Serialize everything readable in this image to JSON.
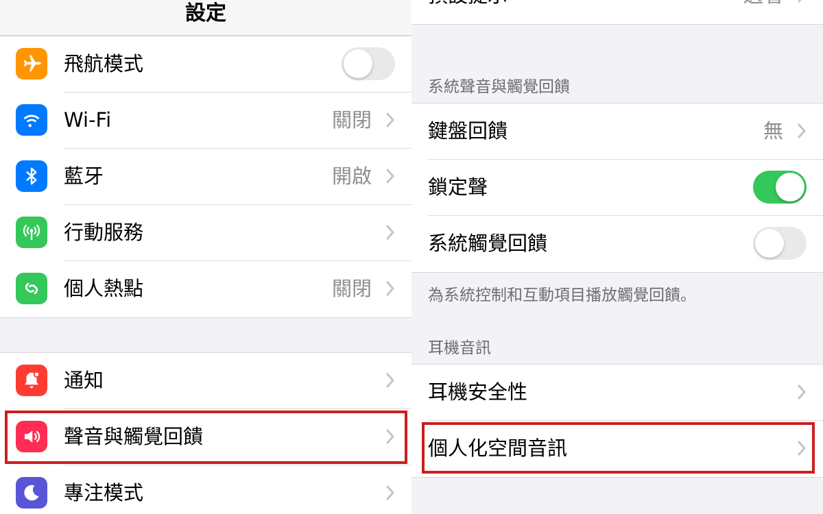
{
  "left": {
    "nav_title": "設定",
    "group1": [
      {
        "label": "飛航模式",
        "icon": "airplane-icon",
        "color": "#ff9500",
        "toggle": false
      },
      {
        "label": "Wi-Fi",
        "icon": "wifi-icon",
        "color": "#007aff",
        "value": "關閉"
      },
      {
        "label": "藍牙",
        "icon": "bluetooth-icon",
        "color": "#007aff",
        "value": "開啟"
      },
      {
        "label": "行動服務",
        "icon": "cellular-icon",
        "color": "#34c759",
        "value": ""
      },
      {
        "label": "個人熱點",
        "icon": "hotspot-icon",
        "color": "#34c759",
        "value": "關閉"
      }
    ],
    "group2": [
      {
        "label": "通知",
        "icon": "bell-icon",
        "color": "#ff3b30"
      },
      {
        "label": "聲音與觸覺回饋",
        "icon": "speaker-icon",
        "color": "#ff2d55",
        "highlighted": true
      },
      {
        "label": "專注模式",
        "icon": "moon-icon",
        "color": "#5856d6"
      }
    ]
  },
  "right": {
    "top_row": {
      "label": "預設提示",
      "value": "過看"
    },
    "section1_header": "系統聲音與觸覺回饋",
    "section1": [
      {
        "label": "鍵盤回饋",
        "value": "無"
      },
      {
        "label": "鎖定聲",
        "toggle": true
      },
      {
        "label": "系統觸覺回饋",
        "toggle": false
      }
    ],
    "section1_footer": "為系統控制和互動項目播放觸覺回饋。",
    "section2_header": "耳機音訊",
    "section2": [
      {
        "label": "耳機安全性"
      },
      {
        "label": "個人化空間音訊",
        "highlighted": true
      }
    ]
  },
  "colors": {
    "highlight": "#cc1f1f",
    "toggle_on": "#34c759",
    "secondary_text": "#8e8e93"
  }
}
